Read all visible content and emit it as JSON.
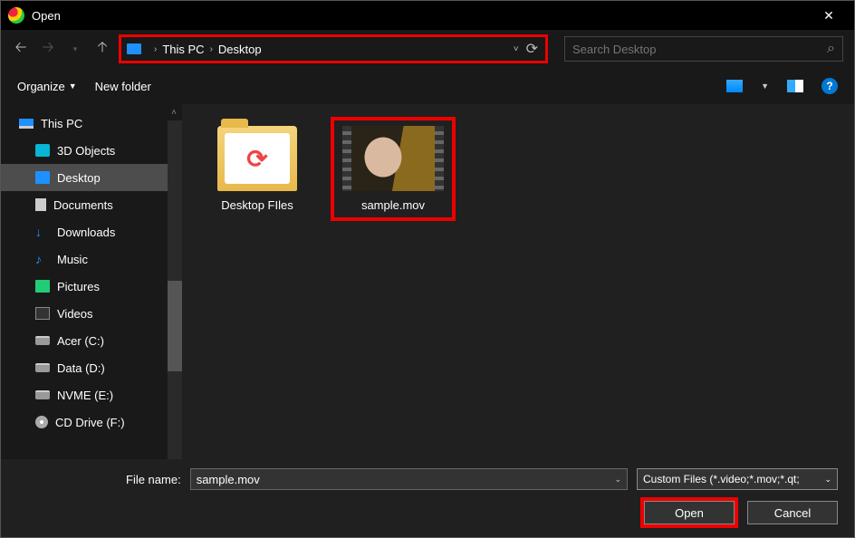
{
  "titlebar": {
    "title": "Open"
  },
  "breadcrumb": {
    "root": "This PC",
    "folder": "Desktop"
  },
  "search": {
    "placeholder": "Search Desktop"
  },
  "toolbar": {
    "organize": "Organize",
    "new_folder": "New folder"
  },
  "sidebar": {
    "items": [
      {
        "label": "This PC",
        "icon": "pc",
        "root": true
      },
      {
        "label": "3D Objects",
        "icon": "3d"
      },
      {
        "label": "Desktop",
        "icon": "desk",
        "selected": true
      },
      {
        "label": "Documents",
        "icon": "doc"
      },
      {
        "label": "Downloads",
        "icon": "dl"
      },
      {
        "label": "Music",
        "icon": "mus"
      },
      {
        "label": "Pictures",
        "icon": "pic"
      },
      {
        "label": "Videos",
        "icon": "vid"
      },
      {
        "label": "Acer (C:)",
        "icon": "drive"
      },
      {
        "label": "Data (D:)",
        "icon": "drive"
      },
      {
        "label": "NVME (E:)",
        "icon": "drive"
      },
      {
        "label": "CD Drive (F:)",
        "icon": "cd"
      }
    ]
  },
  "files": {
    "folder1": "Desktop FIles",
    "video1": "sample.mov"
  },
  "footer": {
    "filename_label": "File name:",
    "filename_value": "sample.mov",
    "filter_label": "Custom Files (*.video;*.mov;*.qt;",
    "open": "Open",
    "cancel": "Cancel"
  }
}
